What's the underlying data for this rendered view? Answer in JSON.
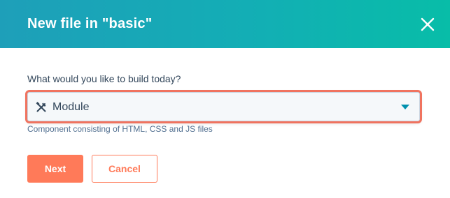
{
  "dialog": {
    "title": "New file in \"basic\"",
    "close_icon": "close-icon"
  },
  "form": {
    "question": "What would you like to build today?",
    "select": {
      "icon": "tools-icon",
      "value": "Module",
      "caret_icon": "caret-down-icon"
    },
    "help_text": "Component consisting of HTML, CSS and JS files"
  },
  "actions": {
    "next_label": "Next",
    "cancel_label": "Cancel"
  },
  "colors": {
    "header_gradient_start": "#1e9fb9",
    "header_gradient_end": "#08bda8",
    "accent": "#ff7a59",
    "focus_ring": "#f0735f",
    "caret": "#0091ae",
    "text": "#33475b"
  }
}
